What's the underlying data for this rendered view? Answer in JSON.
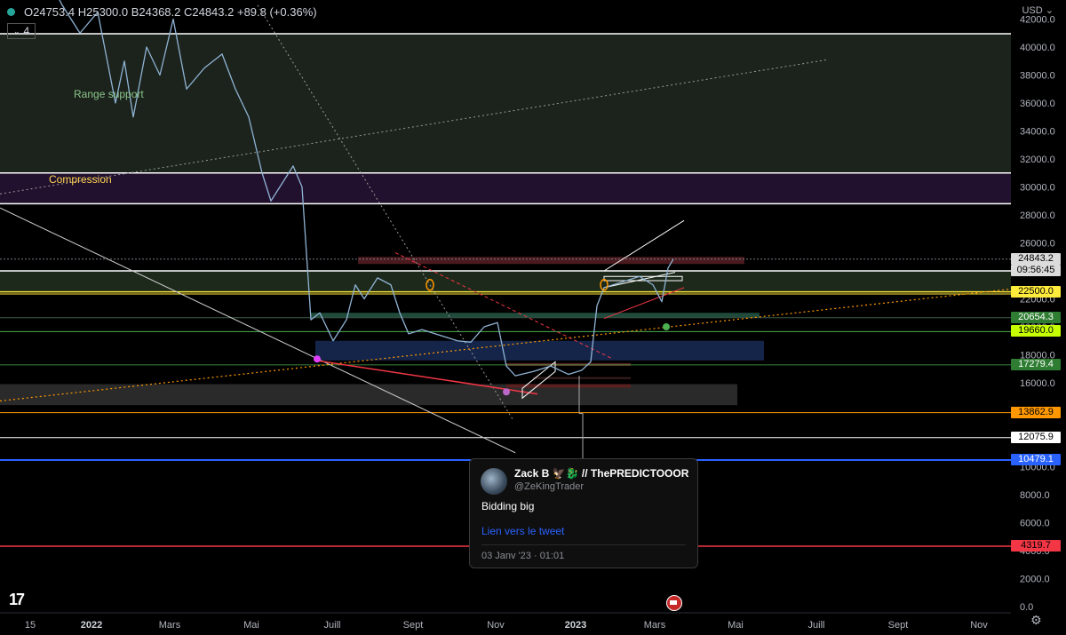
{
  "header": {
    "ohlc": "O24753.4 H25300.0 B24368.2 C24843.2 +89.8 (+0.36%)",
    "interval": "4",
    "currency": "USD"
  },
  "colors": {
    "up": "#26a69a",
    "accent": "#2962ff",
    "pink": "#e91e63"
  },
  "chart_data": {
    "type": "candlestick",
    "title": "",
    "annotations": [
      "Range support",
      "Compression"
    ],
    "x_ticks": [
      "15",
      "2022",
      "Mars",
      "Mai",
      "Juill",
      "Sept",
      "Nov",
      "2023",
      "Mars",
      "Mai",
      "Juill",
      "Sept",
      "Nov"
    ],
    "y_ticks": [
      "42000.0",
      "40000.0",
      "38000.0",
      "36000.0",
      "34000.0",
      "32000.0",
      "30000.0",
      "28000.0",
      "26000.0",
      "24000.0",
      "22000.0",
      "20000.0",
      "18000.0",
      "16000.0",
      "14000.0",
      "12000.0",
      "10000.0",
      "8000.0",
      "6000.0",
      "4000.0",
      "2000.0",
      "0.0"
    ],
    "ylim": [
      0,
      43000
    ],
    "price_levels": [
      {
        "label": "24843.2",
        "sub": "09:56:45"
      },
      {
        "label": "22500.0"
      },
      {
        "label": "20654.3"
      },
      {
        "label": "19660.0"
      },
      {
        "label": "17279.4"
      },
      {
        "label": "13862.9"
      },
      {
        "label": "12075.9"
      },
      {
        "label": "10479.1"
      },
      {
        "label": "4319.7"
      }
    ],
    "price_series": [
      [
        0,
        47000
      ],
      [
        15,
        46500
      ],
      [
        30,
        44000
      ],
      [
        50,
        45500
      ],
      [
        70,
        43000
      ],
      [
        90,
        41000
      ],
      [
        110,
        42500
      ],
      [
        130,
        36000
      ],
      [
        140,
        39000
      ],
      [
        150,
        35000
      ],
      [
        165,
        40000
      ],
      [
        180,
        38000
      ],
      [
        195,
        42000
      ],
      [
        210,
        37000
      ],
      [
        230,
        38500
      ],
      [
        250,
        39500
      ],
      [
        265,
        37000
      ],
      [
        280,
        35000
      ],
      [
        295,
        31000
      ],
      [
        305,
        29000
      ],
      [
        315,
        30000
      ],
      [
        330,
        31500
      ],
      [
        340,
        30000
      ],
      [
        350,
        20500
      ],
      [
        360,
        21000
      ],
      [
        375,
        19000
      ],
      [
        390,
        20500
      ],
      [
        400,
        23000
      ],
      [
        410,
        22000
      ],
      [
        425,
        23500
      ],
      [
        440,
        23000
      ],
      [
        450,
        21000
      ],
      [
        460,
        19500
      ],
      [
        475,
        19800
      ],
      [
        490,
        19500
      ],
      [
        500,
        19300
      ],
      [
        515,
        19000
      ],
      [
        530,
        18900
      ],
      [
        545,
        20000
      ],
      [
        560,
        20300
      ],
      [
        570,
        17200
      ],
      [
        580,
        16500
      ],
      [
        600,
        16800
      ],
      [
        620,
        17200
      ],
      [
        640,
        16600
      ],
      [
        655,
        16900
      ],
      [
        665,
        17500
      ],
      [
        672,
        21500
      ],
      [
        680,
        22800
      ],
      [
        700,
        23200
      ],
      [
        720,
        23600
      ],
      [
        735,
        23000
      ],
      [
        745,
        21800
      ],
      [
        752,
        24200
      ],
      [
        758,
        24843
      ]
    ]
  },
  "tweet": {
    "name": "Zack B 🦅🐉 // ThePREDICTOOOR",
    "handle": "@ZeKingTrader",
    "text": "Bidding big",
    "link": "Lien vers le tweet",
    "date": "03 Janv '23 · 01:01"
  }
}
